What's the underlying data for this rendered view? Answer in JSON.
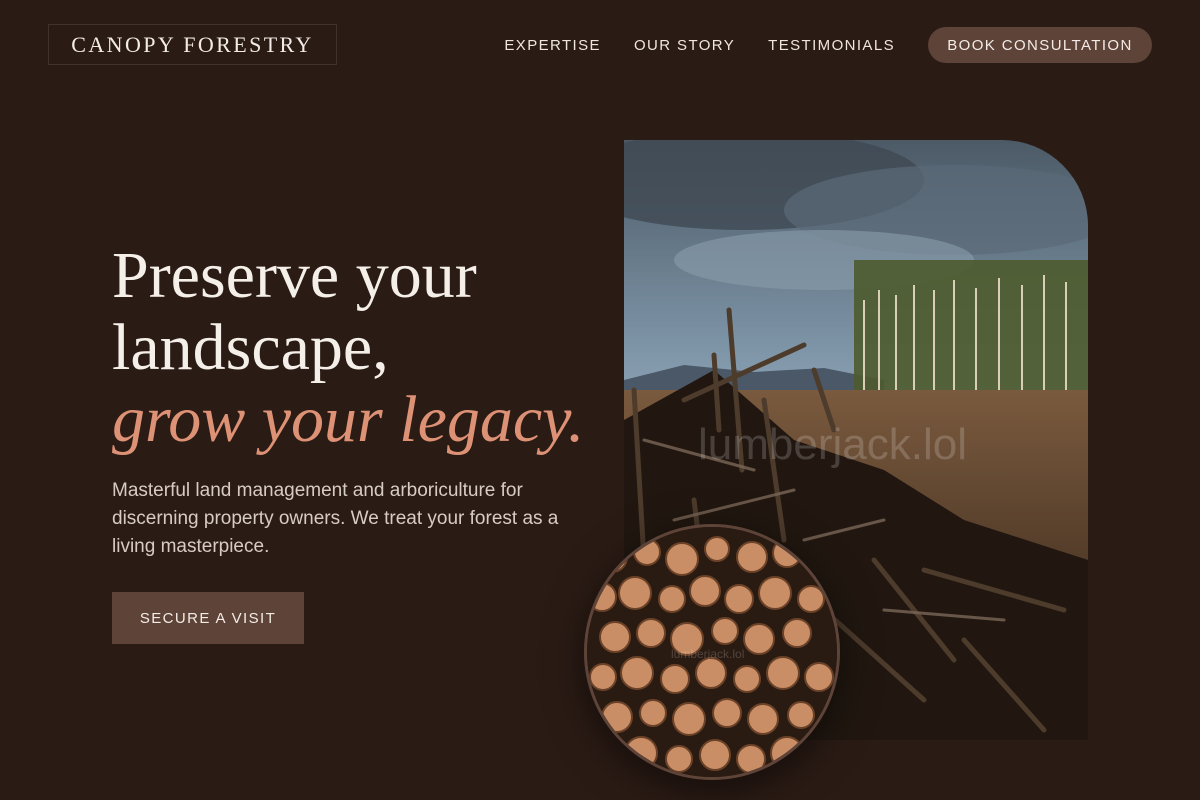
{
  "brand": {
    "logo_text": "CANOPY FORESTRY"
  },
  "nav": {
    "links": [
      "EXPERTISE",
      "OUR STORY",
      "TESTIMONIALS"
    ],
    "cta_label": "BOOK CONSULTATION"
  },
  "hero": {
    "title_line1": "Preserve your",
    "title_line2": "landscape,",
    "title_accent": "grow your legacy.",
    "description": "Masterful land management and arboriculture for discerning property owners. We treat your forest as a living masterpiece.",
    "button_label": "SECURE A VISIT"
  },
  "images": {
    "main_watermark": "lumberjack.lol",
    "circle_watermark": "lumberjack.lol"
  },
  "colors": {
    "background": "#2b1b15",
    "accent": "#dd9175",
    "button": "#5e4338",
    "text": "#f5efe9"
  }
}
